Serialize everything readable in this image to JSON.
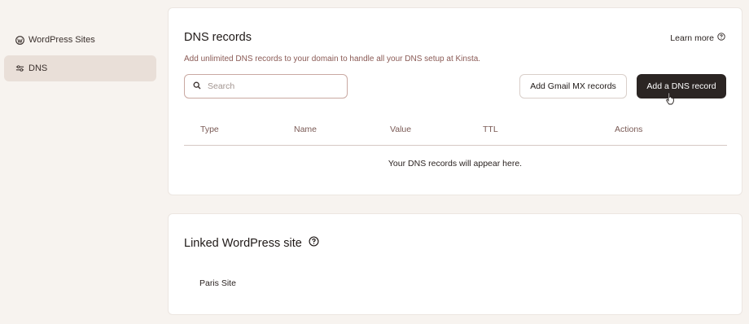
{
  "sidebar": {
    "items": [
      {
        "label": "WordPress Sites",
        "icon": "wordpress-icon",
        "active": false
      },
      {
        "label": "DNS",
        "icon": "sliders-icon",
        "active": true
      }
    ]
  },
  "dns_card": {
    "title": "DNS records",
    "learn_more": "Learn more",
    "subtitle": "Add unlimited DNS records to your domain to handle all your DNS setup at Kinsta.",
    "search_placeholder": "Search",
    "add_gmail_button": "Add Gmail MX records",
    "add_record_button": "Add a DNS record",
    "columns": [
      "Type",
      "Name",
      "Value",
      "TTL",
      "Actions"
    ],
    "empty_message": "Your DNS records will appear here."
  },
  "linked_card": {
    "title": "Linked WordPress site",
    "site_name": "Paris Site"
  },
  "colors": {
    "page_bg": "#f7f3ef",
    "active_nav": "#e9dfd8",
    "primary_button": "#2b2523",
    "subtitle_text": "#8a5a55"
  }
}
